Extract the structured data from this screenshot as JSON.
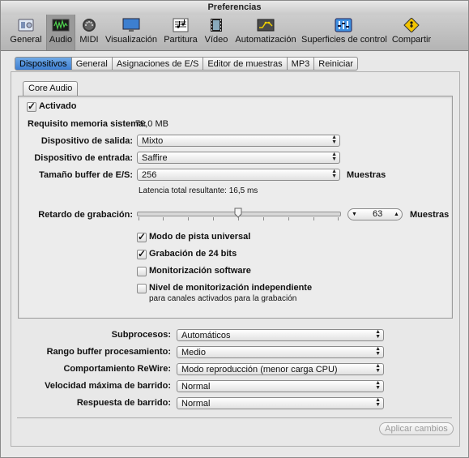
{
  "window": {
    "title": "Preferencias"
  },
  "toolbar": {
    "items": [
      {
        "label": "General",
        "icon": "general-icon"
      },
      {
        "label": "Audio",
        "icon": "audio-icon",
        "selected": true
      },
      {
        "label": "MIDI",
        "icon": "midi-icon"
      },
      {
        "label": "Visualización",
        "icon": "display-icon"
      },
      {
        "label": "Partitura",
        "icon": "score-icon"
      },
      {
        "label": "Vídeo",
        "icon": "video-icon"
      },
      {
        "label": "Automatización",
        "icon": "automation-icon"
      },
      {
        "label": "Superficies de control",
        "icon": "control-surfaces-icon"
      },
      {
        "label": "Compartir",
        "icon": "share-icon"
      }
    ]
  },
  "tabs": [
    {
      "label": "Dispositivos",
      "selected": true
    },
    {
      "label": "General"
    },
    {
      "label": "Asignaciones de E/S"
    },
    {
      "label": "Editor de muestras"
    },
    {
      "label": "MP3"
    },
    {
      "label": "Reiniciar"
    }
  ],
  "core_audio": {
    "tab_label": "Core Audio",
    "enabled_label": "Activado",
    "enabled": true,
    "memory_label": "Requisito memoria sistema:",
    "memory_value": "79,0 MB",
    "output_label": "Dispositivo de salida:",
    "output_value": "Mixto",
    "input_label": "Dispositivo de entrada:",
    "input_value": "Saffire",
    "buffer_label": "Tamaño buffer de E/S:",
    "buffer_value": "256",
    "buffer_unit": "Muestras",
    "latency_text": "Latencia total resultante: 16,5 ms",
    "record_delay_label": "Retardo de grabación:",
    "record_delay_value": "63",
    "record_delay_unit": "Muestras",
    "record_delay_fraction": 0.5,
    "checkboxes": [
      {
        "label": "Modo de pista universal",
        "checked": true
      },
      {
        "label": "Grabación de 24 bits",
        "checked": true
      },
      {
        "label": "Monitorización software",
        "checked": false
      },
      {
        "label": "Nivel de monitorización independiente",
        "checked": false
      }
    ],
    "monitor_note": "para canales activados para la grabación"
  },
  "lower": {
    "rows": [
      {
        "label": "Subprocesos:",
        "value": "Automáticos"
      },
      {
        "label": "Rango buffer procesamiento:",
        "value": "Medio"
      },
      {
        "label": "Comportamiento ReWire:",
        "value": "Modo reproducción (menor carga CPU)"
      },
      {
        "label": "Velocidad máxima de barrido:",
        "value": "Normal"
      },
      {
        "label": "Respuesta de barrido:",
        "value": "Normal"
      }
    ],
    "apply_label": "Aplicar cambios"
  }
}
